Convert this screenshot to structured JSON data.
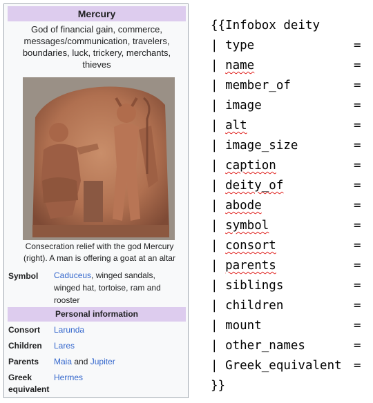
{
  "infobox": {
    "title": "Mercury",
    "subtitle": "God of financial gain, commerce, messages/communication, travelers, boundaries, luck, trickery, merchants, thieves",
    "image_icon": "relief-image",
    "caption": "Consecration relief with the god Mercury (right). A man is offering a goat at an altar",
    "symbol": {
      "label": "Symbol",
      "link": "Caduceus",
      "rest": ", winged sandals, winged hat, tortoise, ram and rooster"
    },
    "section_header": "Personal information",
    "consort": {
      "label": "Consort",
      "link": "Larunda"
    },
    "children": {
      "label": "Children",
      "link": "Lares"
    },
    "parents": {
      "label": "Parents",
      "link1": "Maia",
      "and": " and ",
      "link2": "Jupiter"
    },
    "greek": {
      "label": "Greek equivalent",
      "link": "Hermes"
    },
    "colors": {
      "header_bg": "#ddccee",
      "link": "#3366cc",
      "box_bg": "#f8f9fa",
      "border": "#a2a9b1"
    }
  },
  "code": {
    "open": "{{Infobox deity",
    "pipe": "| ",
    "eq": "=",
    "params": [
      "type",
      "name",
      "member_of",
      "image",
      "alt",
      "image_size",
      "caption",
      "deity_of",
      "abode",
      "symbol",
      "consort",
      "parents",
      "siblings",
      "children",
      "mount",
      "other_names",
      "Greek_equivalent"
    ],
    "close": "}}"
  }
}
